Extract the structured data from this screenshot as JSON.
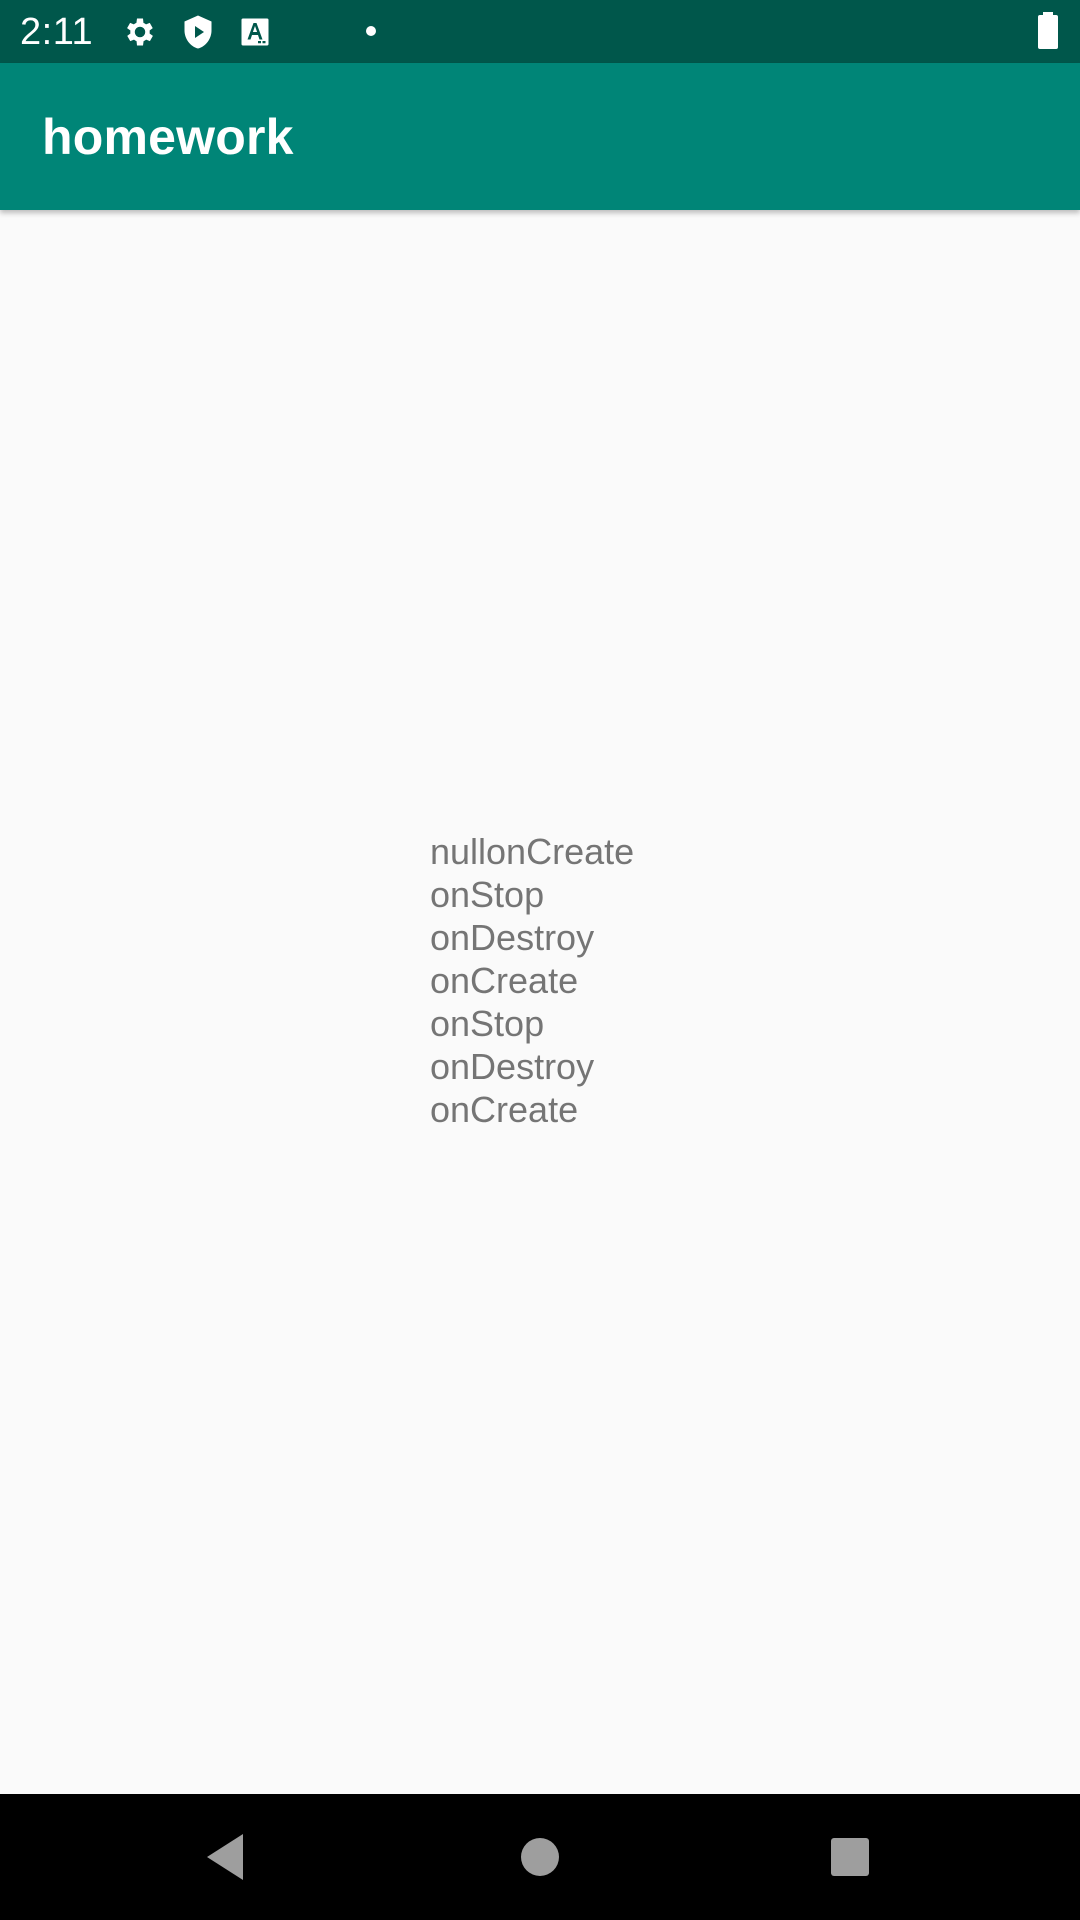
{
  "status_bar": {
    "time": "2:11",
    "icons": [
      "gear-icon",
      "shield-play-icon",
      "font-a-icon",
      "notification-dot-icon",
      "battery-full-icon"
    ]
  },
  "app_bar": {
    "title": "homework",
    "color": "#008577",
    "status_bar_color": "#00574b"
  },
  "content": {
    "log_lines": [
      "nullonCreate",
      "onStop",
      "onDestroy",
      "onCreate",
      "onStop",
      "onDestroy",
      "onCreate"
    ],
    "text_color": "#757575",
    "background": "#fafafa"
  },
  "nav_bar": {
    "buttons": [
      "back-icon",
      "home-icon",
      "recents-icon"
    ]
  }
}
